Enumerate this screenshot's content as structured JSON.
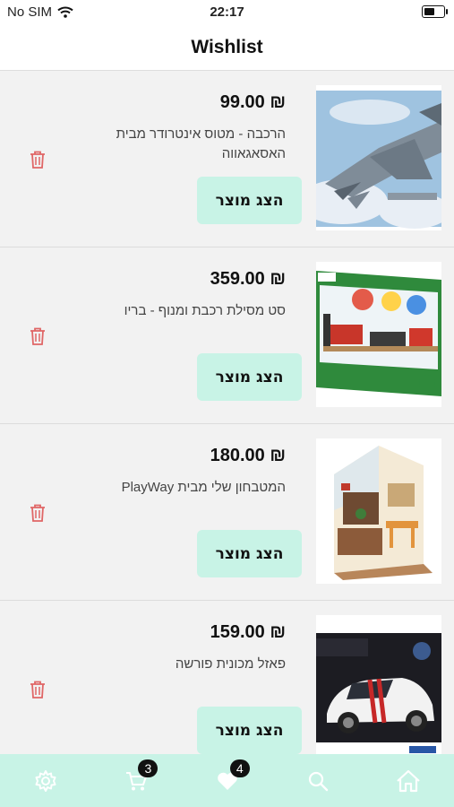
{
  "status_bar": {
    "carrier": "No SIM",
    "time": "22:17",
    "battery_level": 0.55
  },
  "header": {
    "title": "Wishlist"
  },
  "items": [
    {
      "price": "₪ 99.00",
      "title": "הרכבה - מטוס אינטרודר מבית האסאגאווה",
      "button_label": "הצג מוצר",
      "image": "fighter-jet-model"
    },
    {
      "price": "₪ 359.00",
      "title": "סט מסילת רכבת ומנוף - בריו",
      "button_label": "הצג מוצר",
      "image": "brio-rail-crane-set"
    },
    {
      "price": "₪ 180.00",
      "title": "המטבחון שלי מבית PlayWay",
      "button_label": "הצג מוצר",
      "image": "miniature-kitchen-dollhouse"
    },
    {
      "price": "₪ 159.00",
      "title": "פאזל מכונית פורשה",
      "button_label": "הצג מוצר",
      "image": "porsche-3d-puzzle"
    }
  ],
  "tabbar": {
    "tabs": [
      "settings",
      "cart",
      "wishlist",
      "search",
      "home"
    ],
    "cart_badge": "3",
    "wishlist_badge": "4"
  },
  "colors": {
    "accent": "#c8f3e6",
    "delete": "#e06666",
    "background": "#f2f2f2"
  }
}
